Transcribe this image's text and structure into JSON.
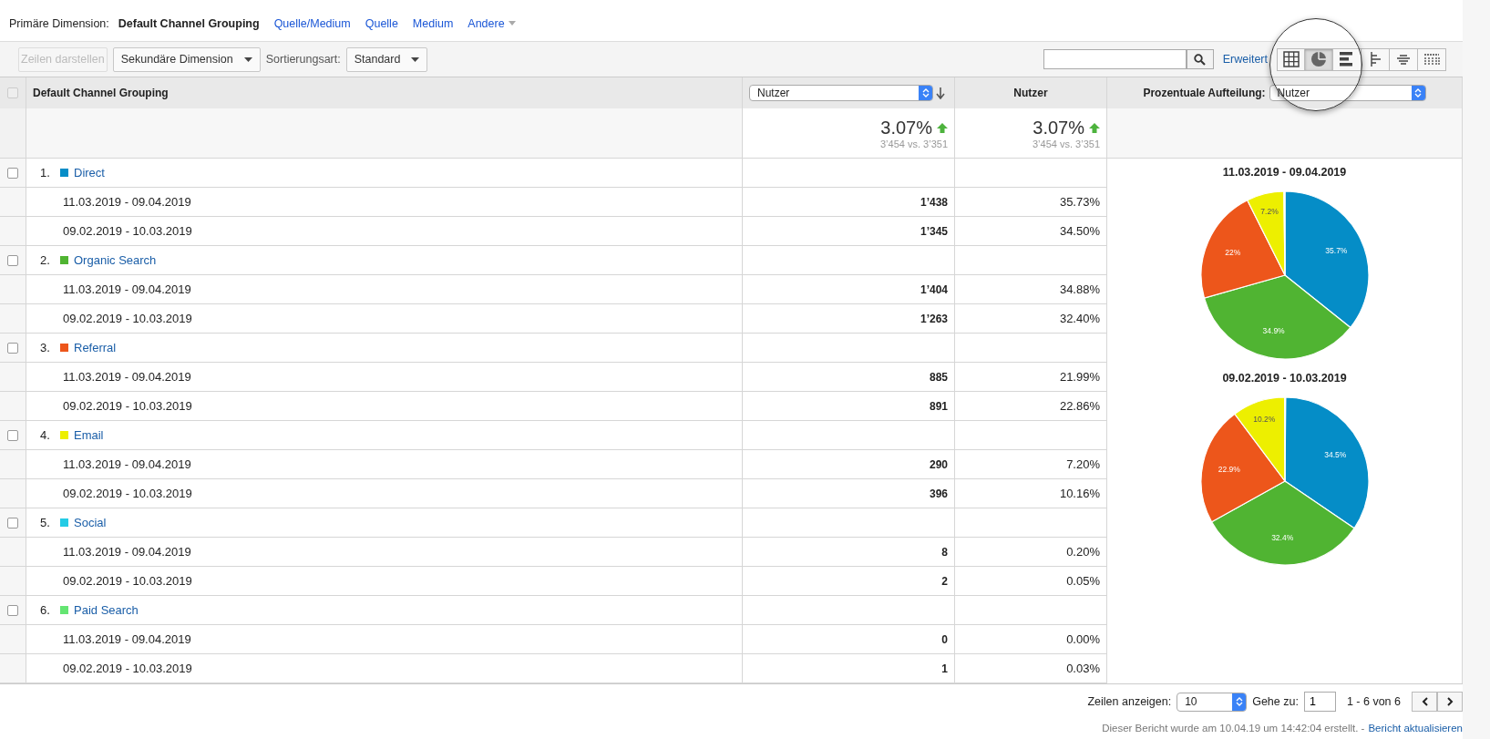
{
  "primary_dimension": {
    "label": "Primäre Dimension:",
    "options": [
      {
        "label": "Default Channel Grouping",
        "selected": true,
        "menu": false
      },
      {
        "label": "Quelle/Medium",
        "selected": false,
        "menu": false
      },
      {
        "label": "Quelle",
        "selected": false,
        "menu": false
      },
      {
        "label": "Medium",
        "selected": false,
        "menu": false
      },
      {
        "label": "Andere",
        "selected": false,
        "menu": true
      }
    ]
  },
  "toolbar": {
    "plot_rows": {
      "label": "Zeilen darstellen",
      "disabled": true
    },
    "secondary_dimension": "Sekundäre Dimension",
    "sort_label": "Sortierungsart:",
    "sort_value": "Standard",
    "advanced_link": "Erweitert",
    "views": [
      {
        "kind": "table",
        "selected": false
      },
      {
        "kind": "pie",
        "selected": true
      },
      {
        "kind": "bar",
        "selected": false
      },
      {
        "kind": "compare",
        "selected": false
      },
      {
        "kind": "cloud",
        "selected": false
      },
      {
        "kind": "pivot",
        "selected": false
      }
    ]
  },
  "table": {
    "select_all_checked": false,
    "dimension_heading": "Default Channel Grouping",
    "metric_select": "Nutzer",
    "metric_heading": "Nutzer",
    "breakdown_label": "Prozentuale Aufteilung:",
    "breakdown_select": "Nutzer",
    "summary": [
      {
        "change": "3.07%",
        "compare": "3’454 vs. 3’351"
      },
      {
        "change": "3.07%",
        "compare": "3’454 vs. 3’351"
      }
    ],
    "rows": [
      {
        "index": "1.",
        "name": "Direct",
        "color": "#058dc7",
        "checked": false,
        "periods": [
          {
            "date": "11.03.2019 - 09.04.2019",
            "users": "1’438",
            "share": "35.73%"
          },
          {
            "date": "09.02.2019 - 10.03.2019",
            "users": "1’345",
            "share": "34.50%"
          }
        ]
      },
      {
        "index": "2.",
        "name": "Organic Search",
        "color": "#50b432",
        "checked": false,
        "periods": [
          {
            "date": "11.03.2019 - 09.04.2019",
            "users": "1’404",
            "share": "34.88%"
          },
          {
            "date": "09.02.2019 - 10.03.2019",
            "users": "1’263",
            "share": "32.40%"
          }
        ]
      },
      {
        "index": "3.",
        "name": "Referral",
        "color": "#ed561b",
        "checked": false,
        "periods": [
          {
            "date": "11.03.2019 - 09.04.2019",
            "users": "885",
            "share": "21.99%"
          },
          {
            "date": "09.02.2019 - 10.03.2019",
            "users": "891",
            "share": "22.86%"
          }
        ]
      },
      {
        "index": "4.",
        "name": "Email",
        "color": "#edef00",
        "checked": false,
        "periods": [
          {
            "date": "11.03.2019 - 09.04.2019",
            "users": "290",
            "share": "7.20%"
          },
          {
            "date": "09.02.2019 - 10.03.2019",
            "users": "396",
            "share": "10.16%"
          }
        ]
      },
      {
        "index": "5.",
        "name": "Social",
        "color": "#24cbe5",
        "checked": false,
        "periods": [
          {
            "date": "11.03.2019 - 09.04.2019",
            "users": "8",
            "share": "0.20%"
          },
          {
            "date": "09.02.2019 - 10.03.2019",
            "users": "2",
            "share": "0.05%"
          }
        ]
      },
      {
        "index": "6.",
        "name": "Paid Search",
        "color": "#64e572",
        "checked": false,
        "periods": [
          {
            "date": "11.03.2019 - 09.04.2019",
            "users": "0",
            "share": "0.00%"
          },
          {
            "date": "09.02.2019 - 10.03.2019",
            "users": "1",
            "share": "0.03%"
          }
        ]
      }
    ],
    "pies": [
      {
        "chart_data": {
          "type": "pie",
          "title": "11.03.2019 - 09.04.2019",
          "values": [
            35.73,
            34.88,
            21.99,
            7.2,
            0.2
          ],
          "value_labels": [
            "35.7%",
            "34.9%",
            "22%",
            "7.2%",
            null
          ]
        }
      },
      {
        "chart_data": {
          "type": "pie",
          "title": "09.02.2019 - 10.03.2019",
          "values": [
            34.5,
            32.4,
            22.86,
            10.16,
            0.05
          ],
          "value_labels": [
            "34.5%",
            "32.4%",
            "22.9%",
            "10.2%",
            null
          ]
        }
      }
    ]
  },
  "pagination": {
    "rows_label": "Zeilen anzeigen:",
    "rows_value": "10",
    "goto_label": "Gehe zu:",
    "goto_value": "1",
    "range": "1 - 6 von 6"
  },
  "footer": {
    "note": "Dieser Bericht wurde am 10.04.19 um 14:42:04 erstellt. -",
    "link": "Bericht aktualisieren"
  }
}
